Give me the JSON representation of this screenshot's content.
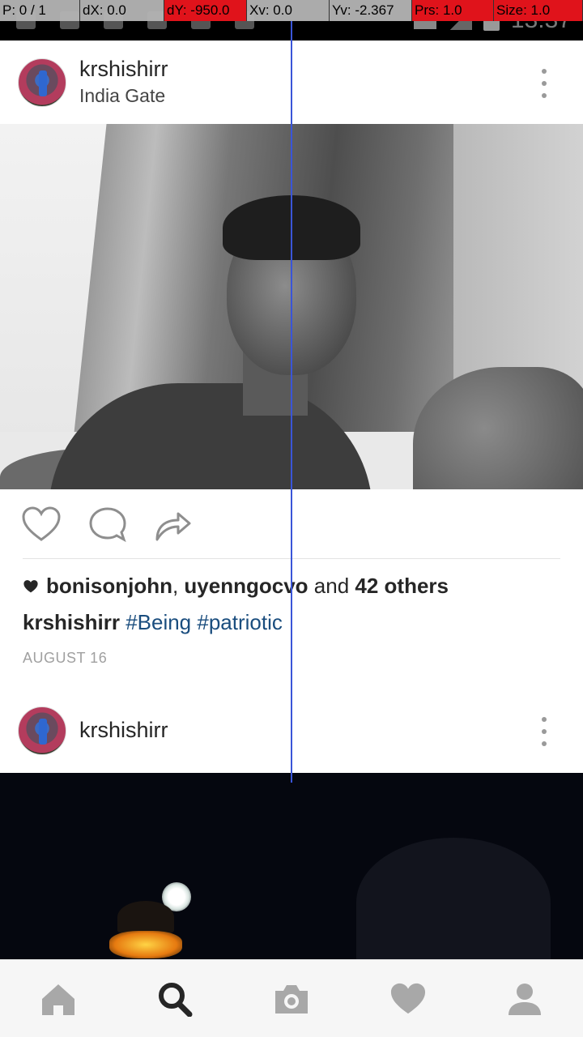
{
  "debug_overlay": {
    "p": "P: 0 / 1",
    "dx": "dX: 0.0",
    "dy": "dY: -950.0",
    "xv": "Xv: 0.0",
    "yv": "Yv: -2.367",
    "prs": "Prs: 1.0",
    "size": "Size: 1.0"
  },
  "status_bar": {
    "time": "13:37"
  },
  "post1": {
    "username": "krshishirr",
    "location": "India Gate",
    "likes_prefix_user1": "bonisonjohn",
    "likes_sep": ", ",
    "likes_prefix_user2": "uyenngocvo",
    "likes_and": " and ",
    "likes_others": "42 others",
    "caption_user": "krshishirr",
    "caption_tags": [
      "#Being",
      "#patriotic"
    ],
    "date": "AUGUST 16",
    "photo_icon": "photo-selfie-india-gate"
  },
  "post2": {
    "username": "krshishirr",
    "photo_icon": "photo-night-monument"
  },
  "actions": {
    "icons": [
      "heart-outline-icon",
      "comment-icon",
      "share-icon"
    ]
  },
  "bottom_nav": {
    "items": [
      "home-icon",
      "search-icon",
      "camera-icon",
      "heart-icon",
      "profile-icon"
    ],
    "active": "search-icon"
  },
  "colors": {
    "hashtag": "#1a4d7e",
    "nav_inactive": "#a8a8a8",
    "nav_active": "#262626",
    "text": "#262626"
  }
}
